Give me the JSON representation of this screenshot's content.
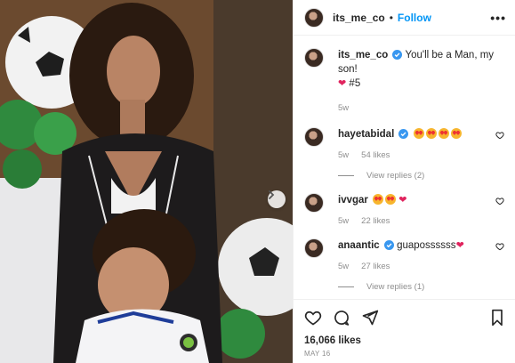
{
  "post": {
    "username": "its_me_co",
    "follow_label": "Follow",
    "separator": "•",
    "more_label": "•••"
  },
  "caption": {
    "username": "its_me_co",
    "text": "You'll be a Man, my son!",
    "heart": "❤",
    "tag": "#5",
    "time": "5w"
  },
  "comments": [
    {
      "username": "hayetabidal",
      "text": "",
      "time": "5w",
      "likes": "54 likes",
      "replies": "View replies (2)",
      "verified": true
    },
    {
      "username": "ivvgar",
      "text": "",
      "time": "5w",
      "likes": "22 likes",
      "replies": "",
      "verified": false
    },
    {
      "username": "anaantic",
      "text": "guapossssss",
      "time": "5w",
      "likes": "27 likes",
      "replies": "View replies (1)",
      "verified": true
    }
  ],
  "emoji": {
    "heart": "❤"
  },
  "footer": {
    "likes": "16,066 likes",
    "date": "MAY 16"
  },
  "colors": {
    "link": "#0095f6",
    "verified": "#3897f0",
    "muted": "#8e8e8e",
    "heart": "#e0245e"
  },
  "icons": [
    "heart-icon",
    "comment-icon",
    "share-icon",
    "bookmark-icon",
    "next-arrow-icon",
    "verified-icon",
    "more-icon"
  ]
}
